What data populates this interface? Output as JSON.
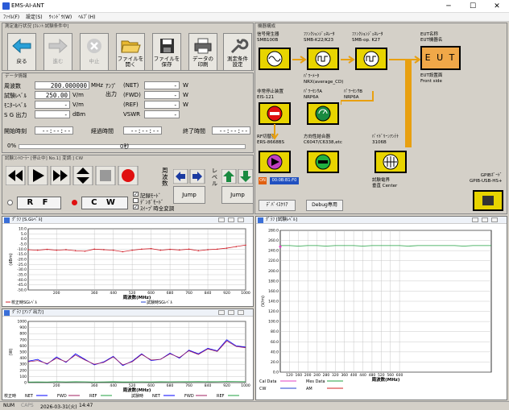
{
  "window": {
    "title": "EMS-AI-ANT",
    "min": "─",
    "max": "☐",
    "close": "✕"
  },
  "menu": [
    "ﾌｧｲﾙ(F)",
    "設定(S)",
    "ｳｨﾝﾄﾞｳ(W)",
    "ﾍﾙﾌﾟ(H)"
  ],
  "status_panel": {
    "header": "測定進行状況 [ｶﾚﾝﾄ:試験条件中]"
  },
  "toolbar": [
    {
      "label": "戻る",
      "icon": "arrow-left-icon",
      "enabled": true
    },
    {
      "label": "進む",
      "icon": "arrow-right-icon",
      "enabled": false
    },
    {
      "label": "中止",
      "icon": "stop-x-icon",
      "enabled": false
    },
    {
      "label": "ファイルを\n開く",
      "icon": "folder-open-icon",
      "enabled": true
    },
    {
      "label": "ファイルを\n保存",
      "icon": "floppy-save-icon",
      "enabled": true
    },
    {
      "label": "データの\n印刷",
      "icon": "printer-icon",
      "enabled": true
    },
    {
      "label": "測定条件\n設定",
      "icon": "wrench-icon",
      "enabled": true
    }
  ],
  "data_info": {
    "header": "データ情報",
    "rows": [
      {
        "label": "周波数",
        "value": "200.000000",
        "unit": "MHz"
      },
      {
        "label": "試験ﾚﾍﾞﾙ",
        "value": "250.00",
        "unit": "V/m"
      },
      {
        "label": "ﾓﾆﾀｰﾚﾍﾞﾙ",
        "value": "-",
        "unit": "V/m"
      },
      {
        "label": "S G 出力",
        "value": "-",
        "unit": "dBm"
      }
    ],
    "amp_label": "ｱﾝﾌﾟ\n出力",
    "amp_rows": [
      {
        "label": "(NET)",
        "value": "-",
        "unit": "W"
      },
      {
        "label": "(FWD)",
        "value": "-",
        "unit": "W"
      },
      {
        "label": "(REF)",
        "value": "-",
        "unit": "W"
      },
      {
        "label": "VSWR",
        "value": "-",
        "unit": ""
      }
    ],
    "start_label": "開始時刻",
    "start_value": "--:--:--",
    "elapsed_label": "経過時間",
    "elapsed_value": "--:--:--",
    "end_label": "終了時間",
    "end_value": "--:--:--",
    "progress_left": "0%",
    "progress_mid": "0秒",
    "progress": 0
  },
  "test_controller": {
    "header": "試験ｺﾝﾄﾛｰﾗｰ [停止中] No.1] 変調:] CW",
    "dwell_label": "周\n波\n数",
    "level_label": "レ\nベ\nル",
    "jump1": "Jump",
    "jump2": "Jump",
    "rf_label": "R F",
    "cw_label": "C W",
    "checks": [
      "記録ﾓｰﾄﾞ",
      "ﾃﾞﾝﾎﾞﾓｰﾄﾞ",
      "ｽｲｰﾌﾟ時全変調"
    ]
  },
  "equipment": {
    "header": "機器構成",
    "sg": "信号発生器\nSMB100B",
    "fg1": "ﾌｧﾝｸｼｮﾝｼﾞｪﾈﾚｰﾀ\nSMB-K22/K23",
    "fg2": "ﾌｧﾝｸｼｮﾝｼﾞｪﾈﾚｰﾀ\nSMB-op. K27",
    "eut": "EUT名称\nEUT機器名",
    "eut_box": "E U T",
    "eut_setup": "EUT設置面\nFront side",
    "pm": "ﾊﾟﾜｰﾒｰﾀ\nNRX(average_CD)",
    "ps1": "ﾊﾟﾜｰｾﾝｻA\nNRP6A",
    "ps2": "ﾊﾟﾜｰｾﾝｻB\nNRP6A",
    "estop": "非常停止装置\nEIS-121",
    "rfsw": "RF切替器\nERS-8668BS",
    "coupler": "方向性結合器\nC6047/C6338,etc",
    "ant": "ﾊﾞｲﾄﾞﾘｰﾝｱﾝﾃﾅ\n3106B",
    "field": "試験電界\n垂直 Center",
    "gpib": "GPIBﾎﾞｰﾄﾞ\nGPIB-USB-HS+",
    "on_badge": "ON",
    "addr_badge": "00:0B:B1:F0",
    "btn_device_clear": "ﾃﾞﾊﾞｲｽｸﾘｱ",
    "btn_debug": "Debug専用"
  },
  "chart_sg": {
    "title": "ｸﾞﾗﾌ [S.Gﾚﾍﾞﾙ]",
    "ylabel": "(dBm)",
    "xlabel": "周波数(MHz)",
    "legend": [
      "校正時SGﾚﾍﾞﾙ",
      "試験時SGﾚﾍﾞﾙ"
    ],
    "colors": {
      "cal": "#d0202a",
      "test": "#2040d0"
    }
  },
  "chart_amp": {
    "title": "ｸﾞﾗﾌ [ｱﾝﾌﾟ出力]",
    "ylabel": "(W)",
    "xlabel": "周波数(MHz)",
    "left_label": "校正時",
    "right_label": "試験時",
    "legend_cal": [
      "NET",
      "FWD",
      "REF"
    ],
    "legend_test": [
      "NET",
      "FWD",
      "REF"
    ],
    "colors": {
      "net": "#0000ff",
      "fwd": "#a02060",
      "ref": "#20a040"
    }
  },
  "chart_field": {
    "title": "ｸﾞﾗﾌ [試験ﾚﾍﾞﾙ]",
    "ylabel": "(V/m)",
    "xlabel": "周波数(MHz)",
    "legend": [
      "Cal Data",
      "Mes Data",
      "CW",
      "AM"
    ],
    "colors": {
      "cal": "#e040c0",
      "mes": "#20a040",
      "cw": "#2040d0",
      "am": "#d02020"
    }
  },
  "chart_data": [
    {
      "type": "line",
      "title": "ｸﾞﾗﾌ [S.Gﾚﾍﾞﾙ]",
      "xlabel": "周波数(MHz)",
      "ylabel": "(dBm)",
      "x": [
        80,
        120,
        160,
        200,
        240,
        280,
        320,
        360,
        400,
        440,
        480,
        520,
        560,
        600,
        640,
        680,
        720,
        760,
        800,
        840,
        880,
        920,
        960,
        1000
      ],
      "ylim": [
        -50,
        10
      ],
      "yticks": [
        10,
        5,
        0,
        -5,
        -10,
        -15,
        -20,
        -25,
        -30,
        -35,
        -40,
        -45,
        -50
      ],
      "xticks": [
        200,
        360,
        440,
        520,
        600,
        680,
        760,
        840,
        920,
        1000
      ],
      "series": [
        {
          "name": "校正時SGﾚﾍﾞﾙ",
          "values": [
            -10.5,
            -11,
            -10.2,
            -11,
            -10.5,
            -11.5,
            -12,
            -10,
            -10.5,
            -11,
            -12.5,
            -11,
            -10,
            -9.5,
            -11,
            -10.2,
            -10.8,
            -10,
            -11.5,
            -10.5,
            -10,
            -9,
            -7.5,
            -6
          ]
        }
      ]
    },
    {
      "type": "line",
      "title": "ｸﾞﾗﾌ [ｱﾝﾌﾟ出力]",
      "xlabel": "周波数(MHz)",
      "ylabel": "(W)",
      "x": [
        80,
        120,
        160,
        200,
        240,
        280,
        320,
        360,
        400,
        440,
        480,
        520,
        560,
        600,
        640,
        680,
        720,
        760,
        800,
        840,
        880,
        920,
        960,
        1000
      ],
      "ylim": [
        0,
        1000
      ],
      "yticks": [
        0,
        100,
        200,
        300,
        400,
        500,
        600,
        700,
        800,
        900,
        1000
      ],
      "xticks": [
        200,
        360,
        440,
        520,
        600,
        680,
        760,
        840,
        920,
        1000
      ],
      "series": [
        {
          "name": "NET",
          "values": [
            350,
            380,
            300,
            420,
            330,
            470,
            380,
            290,
            340,
            430,
            280,
            350,
            470,
            360,
            380,
            480,
            400,
            530,
            470,
            560,
            520,
            700,
            600,
            580
          ]
        },
        {
          "name": "FWD",
          "values": [
            340,
            360,
            310,
            400,
            340,
            450,
            370,
            300,
            330,
            420,
            290,
            340,
            460,
            370,
            380,
            470,
            410,
            520,
            460,
            550,
            510,
            680,
            590,
            570
          ]
        },
        {
          "name": "REF",
          "values": [
            10,
            12,
            10,
            15,
            12,
            14,
            13,
            10,
            12,
            14,
            11,
            12,
            13,
            12,
            14,
            13,
            15,
            14,
            16,
            14,
            15,
            18,
            16,
            15
          ]
        }
      ]
    },
    {
      "type": "line",
      "title": "ｸﾞﾗﾌ [試験ﾚﾍﾞﾙ]",
      "xlabel": "周波数(MHz)",
      "ylabel": "(V/m)",
      "x": [
        80,
        120,
        160,
        200,
        240,
        280,
        320,
        360,
        400,
        440,
        480,
        520,
        560,
        600,
        640,
        680,
        720,
        760,
        800,
        840,
        880,
        920,
        960,
        1000
      ],
      "ylim": [
        0,
        280
      ],
      "yticks": [
        0,
        20,
        40,
        60,
        80,
        100,
        120,
        140,
        160,
        180,
        200,
        220,
        240,
        260,
        280
      ],
      "xticks": [
        120,
        160,
        200,
        240,
        280,
        320,
        360,
        400,
        440,
        480,
        520,
        560,
        600
      ],
      "series": [
        {
          "name": "Mes Data",
          "values": [
            250,
            250,
            249,
            250,
            250,
            249,
            250,
            250,
            250,
            249,
            250,
            250,
            250,
            250,
            249,
            250,
            250,
            250,
            250,
            250,
            249,
            250,
            250,
            250
          ]
        }
      ]
    }
  ],
  "statusbar": {
    "num": "NUM",
    "caps": "CAPS",
    "date": "2026-03-31(火)",
    "time": "14:47"
  }
}
